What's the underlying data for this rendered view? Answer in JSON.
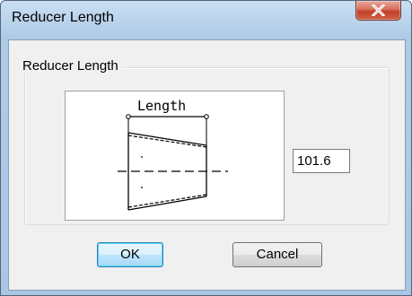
{
  "window": {
    "title": "Reducer Length",
    "close_icon": "close-icon"
  },
  "group": {
    "label": "Reducer Length"
  },
  "diagram": {
    "icon": "reducer-length-diagram",
    "label": "Length"
  },
  "length_field": {
    "value": "101.6"
  },
  "buttons": {
    "ok_label": "OK",
    "cancel_label": "Cancel"
  },
  "colors": {
    "title_bar": "#bcd5ec",
    "close_button": "#c94a35",
    "client_background": "#f0f0f0",
    "default_button_border": "#3c7fb1"
  }
}
